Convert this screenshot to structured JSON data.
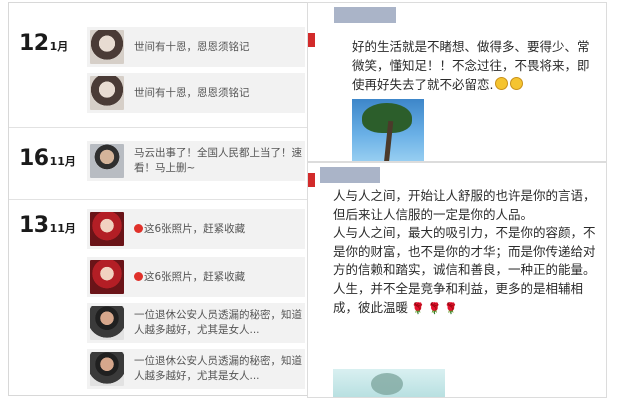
{
  "timeline": {
    "groups": [
      {
        "day": "12",
        "month": "1月"
      },
      {
        "day": "16",
        "month": "11月"
      },
      {
        "day": "13",
        "month": "11月"
      }
    ],
    "items": [
      {
        "thumb": "girl-portrait-thumbnail",
        "text": "世间有十恩，恩恩须铭记"
      },
      {
        "thumb": "girl-portrait-thumbnail",
        "text": "世间有十恩，恩恩须铭记"
      },
      {
        "thumb": "man-portrait-thumbnail",
        "text": "马云出事了！全国人民都上当了！速看！马上删~"
      },
      {
        "thumb": "red-costume-thumbnail",
        "text": "这6张照片，赶紧收藏"
      },
      {
        "thumb": "red-costume-thumbnail",
        "text": "这6张照片，赶紧收藏"
      },
      {
        "thumb": "police-officer-thumbnail",
        "text": "一位退休公安人员透漏的秘密，知道人越多越好，尤其是女人..."
      },
      {
        "thumb": "police-officer-thumbnail",
        "text": "一位退休公安人员透漏的秘密，知道人越多越好，尤其是女人..."
      }
    ]
  },
  "post_top": {
    "text": "好的生活就是不睹想、做得多、要得少、常微笑，懂知足！！不念过往，不畏将来，即使再好失去了就不必留恋.",
    "emoji": [
      "sun-emoji",
      "sun-emoji"
    ],
    "image": "palm-tree-photo"
  },
  "post_bottom": {
    "paragraphs": [
      "人与人之间，开始让人舒服的也许是你的言语，但后来让人信服的一定是你的人品。",
      "人与人之间，最大的吸引力，不是你的容颜，不是你的财富，也不是你的才华；而是你传递给对方的信赖和踏实，诚信和善良，一种正的能量。",
      "人生，并不全是竞争和利益，更多的是相辅相成，彼此温暖"
    ],
    "roses": [
      "🌹",
      "🌹",
      "🌹"
    ],
    "image": "beach-tree-photo"
  },
  "colors": {
    "accent_red": "#d22b2b",
    "item_bg": "#f2f2f2",
    "blur": "#8e9bb5"
  }
}
